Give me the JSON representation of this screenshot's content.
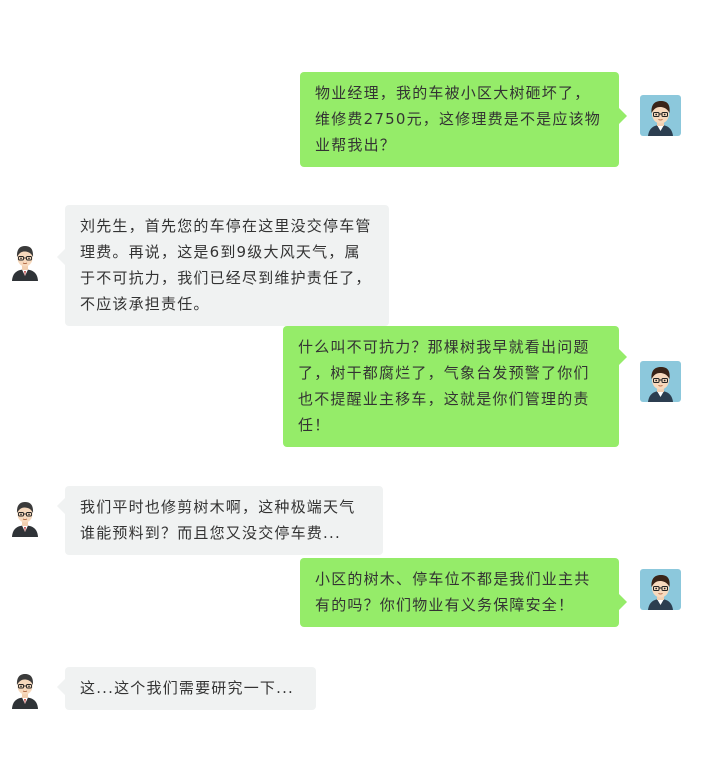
{
  "conversation": {
    "messages": [
      {
        "sender": "me",
        "text": "物业经理，我的车被小区大树砸坏了，维修费2750元，这修理费是不是应该物业帮我出？"
      },
      {
        "sender": "them",
        "text": "刘先生，首先您的车停在这里没交停车管理费。再说，这是6到9级大风天气，属于不可抗力，我们已经尽到维护责任了，不应该承担责任。"
      },
      {
        "sender": "me",
        "text": "什么叫不可抗力？那棵树我早就看出问题了，树干都腐烂了，气象台发预警了你们也不提醒业主移车，这就是你们管理的责任！"
      },
      {
        "sender": "them",
        "text": "我们平时也修剪树木啊，这种极端天气谁能预料到？而且您又没交停车费..."
      },
      {
        "sender": "me",
        "text": "小区的树木、停车位不都是我们业主共有的吗？你们物业有义务保障安全！"
      },
      {
        "sender": "them",
        "text": "这...这个我们需要研究一下..."
      }
    ]
  },
  "colors": {
    "my_bubble": "#95ec69",
    "their_bubble": "#f0f2f2",
    "text": "#333333",
    "my_avatar_bg": "#8cc8dc",
    "manager_suit": "#2f3337"
  },
  "icons": {
    "my_avatar": "young-man-glasses-avatar-icon",
    "manager_avatar": "manager-suit-avatar-icon"
  }
}
